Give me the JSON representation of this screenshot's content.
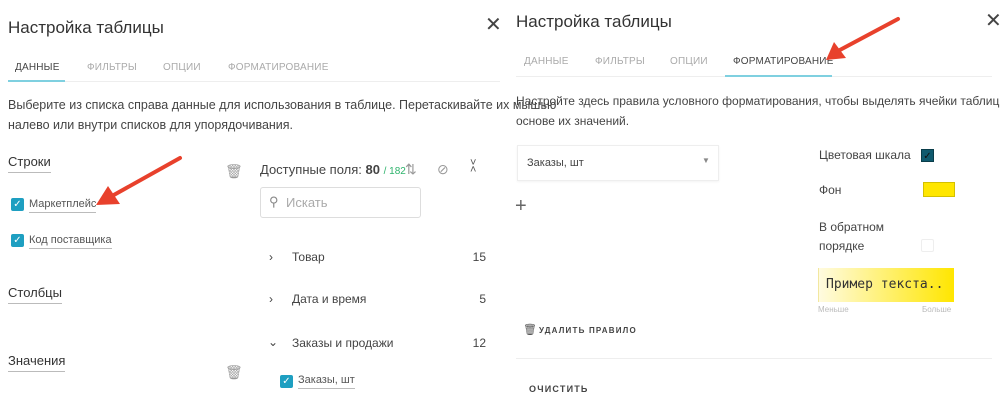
{
  "left": {
    "title": "Настройка таблицы",
    "tabs": [
      {
        "label": "ДАННЫЕ",
        "active": true
      },
      {
        "label": "ФИЛЬТРЫ"
      },
      {
        "label": "ОПЦИИ"
      },
      {
        "label": "ФОРМАТИРОВАНИЕ"
      }
    ],
    "description": [
      "Выберите из списка справа данные для использования в таблице. Перетаскивайте их мышью",
      "налево или внутри списков для упорядочивания."
    ],
    "rows_label": "Строки",
    "rows": [
      {
        "label": "Маркетплейс",
        "checked": true
      },
      {
        "label": "Код поставщика",
        "checked": true
      }
    ],
    "columns_label": "Столбцы",
    "values_label": "Значения",
    "available": {
      "label": "Доступные поля:",
      "count": "80",
      "total": "/ 182",
      "total_color": "#2db36b"
    },
    "search_placeholder": "Искать",
    "groups": [
      {
        "label": "Товар",
        "count": "15",
        "expanded": false
      },
      {
        "label": "Дата и время",
        "count": "5",
        "expanded": false
      },
      {
        "label": "Заказы и продажи",
        "count": "12",
        "expanded": true
      }
    ],
    "group_items": [
      {
        "label": "Заказы, шт",
        "checked": true
      }
    ]
  },
  "right": {
    "title": "Настройка таблицы",
    "tabs": [
      {
        "label": "ДАННЫЕ"
      },
      {
        "label": "ФИЛЬТРЫ"
      },
      {
        "label": "ОПЦИИ"
      },
      {
        "label": "ФОРМАТИРОВАНИЕ",
        "active": true
      }
    ],
    "description": [
      "Настройте здесь правила условного форматирования, чтобы выделять ячейки таблицы на",
      "основе их значений."
    ],
    "field_select": "Заказы, шт",
    "add": "+",
    "color_scale_label": "Цветовая шкала",
    "color_scale_checked": true,
    "bg_label": "Фон",
    "bg_color": "#ffe600",
    "reverse_label": [
      "В обратном",
      "порядке"
    ],
    "reverse_checked": false,
    "sample_text": "Пример текста..",
    "less": "Меньше",
    "more": "Больше",
    "delete_rule": "УДАЛИТЬ ПРАВИЛО",
    "clear": "ОЧИСТИТЬ"
  },
  "accent": "#1e9fc1",
  "arrow_color": "#e8412c"
}
